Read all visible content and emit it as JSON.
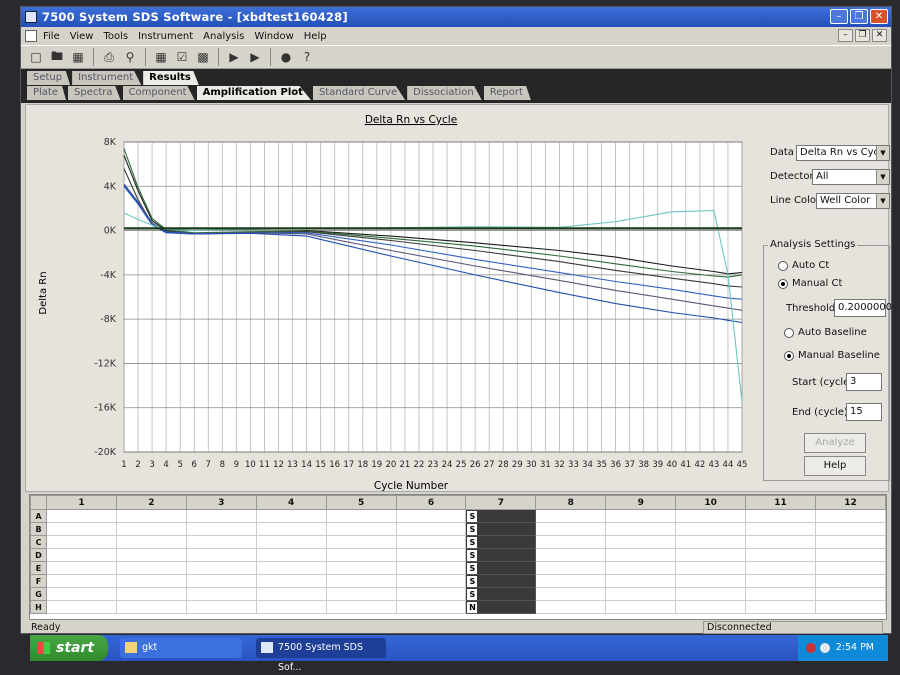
{
  "window": {
    "title": "7500 System SDS Software - [xbdtest160428]"
  },
  "menu": [
    "File",
    "View",
    "Tools",
    "Instrument",
    "Analysis",
    "Window",
    "Help"
  ],
  "tabs_top": [
    {
      "label": "Setup",
      "active": false
    },
    {
      "label": "Instrument",
      "active": false
    },
    {
      "label": "Results",
      "active": true
    }
  ],
  "tabs_sub": [
    {
      "label": "Plate",
      "active": false
    },
    {
      "label": "Spectra",
      "active": false
    },
    {
      "label": "Component",
      "active": false
    },
    {
      "label": "Amplification Plot",
      "active": true
    },
    {
      "label": "Standard Curve",
      "active": false
    },
    {
      "label": "Dissociation",
      "active": false
    },
    {
      "label": "Report",
      "active": false
    }
  ],
  "controls": {
    "data_label": "Data",
    "data_value": "Delta Rn vs Cycle",
    "detector_label": "Detector",
    "detector_value": "All",
    "linecolor_label": "Line Color",
    "linecolor_value": "Well Color",
    "analysis_settings": "Analysis Settings",
    "auto_ct": "Auto Ct",
    "manual_ct": "Manual Ct",
    "threshold_label": "Threshold",
    "threshold_value": "0.2000000",
    "auto_baseline": "Auto Baseline",
    "manual_baseline": "Manual Baseline",
    "start_label": "Start (cycle)",
    "start_value": "3",
    "end_label": "End (cycle)",
    "end_value": "15",
    "analyze": "Analyze",
    "help": "Help"
  },
  "chart_data": {
    "type": "line",
    "title": "Delta Rn vs Cycle",
    "xlabel": "Cycle Number",
    "ylabel": "Delta Rn",
    "xlim": [
      1,
      45
    ],
    "ylim": [
      -20000,
      8000
    ],
    "yticks": [
      8000,
      4000,
      0,
      -4000,
      -8000,
      -12000,
      -16000,
      -20000
    ],
    "ytick_labels": [
      "8K",
      "4K",
      "0K",
      "-4K",
      "-8K",
      "-12K",
      "-16K",
      "-20K"
    ],
    "x": [
      1,
      2,
      3,
      4,
      6,
      10,
      14,
      20,
      26,
      32,
      36,
      40,
      43,
      44,
      45
    ],
    "threshold": 200,
    "grid": true,
    "series": [
      {
        "color": "#1a1a1a",
        "values": [
          6800,
          3600,
          900,
          0,
          -300,
          -150,
          0,
          -500,
          -1100,
          -1800,
          -2400,
          -3200,
          -3700,
          -3900,
          -3800
        ]
      },
      {
        "color": "#2d6a3a",
        "values": [
          7400,
          3900,
          1100,
          100,
          -200,
          -100,
          -50,
          -700,
          -1400,
          -2300,
          -3000,
          -3700,
          -4100,
          -4200,
          -4000
        ]
      },
      {
        "color": "#3a3a3a",
        "values": [
          5600,
          2800,
          600,
          -100,
          -300,
          -200,
          -100,
          -900,
          -1800,
          -2800,
          -3600,
          -4300,
          -4800,
          -5000,
          -5100
        ]
      },
      {
        "color": "#2f62c8",
        "values": [
          4000,
          2400,
          500,
          -200,
          -300,
          -200,
          -200,
          -1300,
          -2600,
          -3800,
          -4600,
          -5300,
          -5900,
          -6100,
          -6200
        ]
      },
      {
        "color": "#5a5a7a",
        "values": [
          4200,
          2600,
          700,
          -100,
          -250,
          -200,
          -300,
          -1800,
          -3200,
          -4500,
          -5400,
          -6200,
          -6800,
          -7000,
          -7200
        ]
      },
      {
        "color": "#1d4fb0",
        "values": [
          4100,
          2500,
          600,
          -150,
          -300,
          -250,
          -500,
          -2300,
          -4000,
          -5600,
          -6600,
          -7400,
          -7900,
          -8100,
          -8300
        ]
      },
      {
        "color": "#6fc6c0",
        "values": [
          1600,
          1000,
          500,
          100,
          0,
          100,
          200,
          250,
          350,
          300,
          800,
          1700,
          1800,
          -4000,
          -15500
        ]
      }
    ]
  },
  "plate": {
    "columns": [
      "1",
      "2",
      "3",
      "4",
      "5",
      "6",
      "7",
      "8",
      "9",
      "10",
      "11",
      "12"
    ],
    "rows": [
      "A",
      "B",
      "C",
      "D",
      "E",
      "F",
      "G",
      "H"
    ],
    "col7_wells": [
      "S",
      "S",
      "S",
      "S",
      "S",
      "S",
      "S",
      "N"
    ]
  },
  "status": {
    "left": "Ready",
    "right": "Disconnected"
  },
  "taskbar": {
    "start": "start",
    "tasks": [
      "gkt",
      "7500 System SDS Sof..."
    ],
    "clock": "2:54 PM"
  }
}
